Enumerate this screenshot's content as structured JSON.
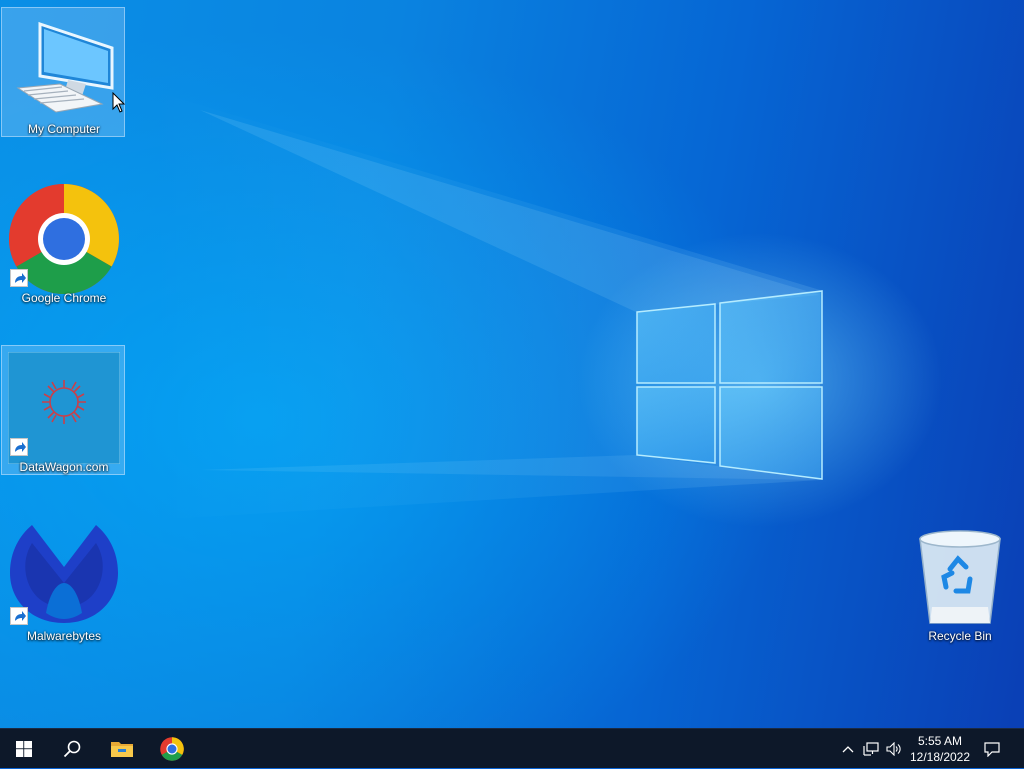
{
  "desktop": {
    "icons": [
      {
        "label": "My Computer",
        "icon": "computer-icon",
        "selected": true
      },
      {
        "label": "Google Chrome",
        "icon": "chrome-icon",
        "shortcut": true
      },
      {
        "label": "DataWagon.com",
        "icon": "datawagon-icon",
        "shortcut": true,
        "selected": true
      },
      {
        "label": "Malwarebytes",
        "icon": "malwarebytes-icon",
        "shortcut": true
      },
      {
        "label": "Recycle Bin",
        "icon": "recycle-bin-icon"
      }
    ]
  },
  "taskbar": {
    "start": {
      "icon": "windows-start-icon"
    },
    "search": {
      "icon": "search-icon"
    },
    "pinned": [
      {
        "icon": "file-explorer-icon"
      },
      {
        "icon": "chrome-icon"
      }
    ],
    "tray": [
      {
        "icon": "chevron-up-icon"
      },
      {
        "icon": "network-icon"
      },
      {
        "icon": "volume-icon"
      }
    ],
    "clock": {
      "time": "5:55 AM",
      "date": "12/18/2022"
    },
    "notification": {
      "icon": "notification-icon"
    }
  },
  "colors": {
    "taskbar_bg": "#0d1829",
    "wallpaper_blue": "#0a83e0",
    "accent": "#1e90ff"
  }
}
